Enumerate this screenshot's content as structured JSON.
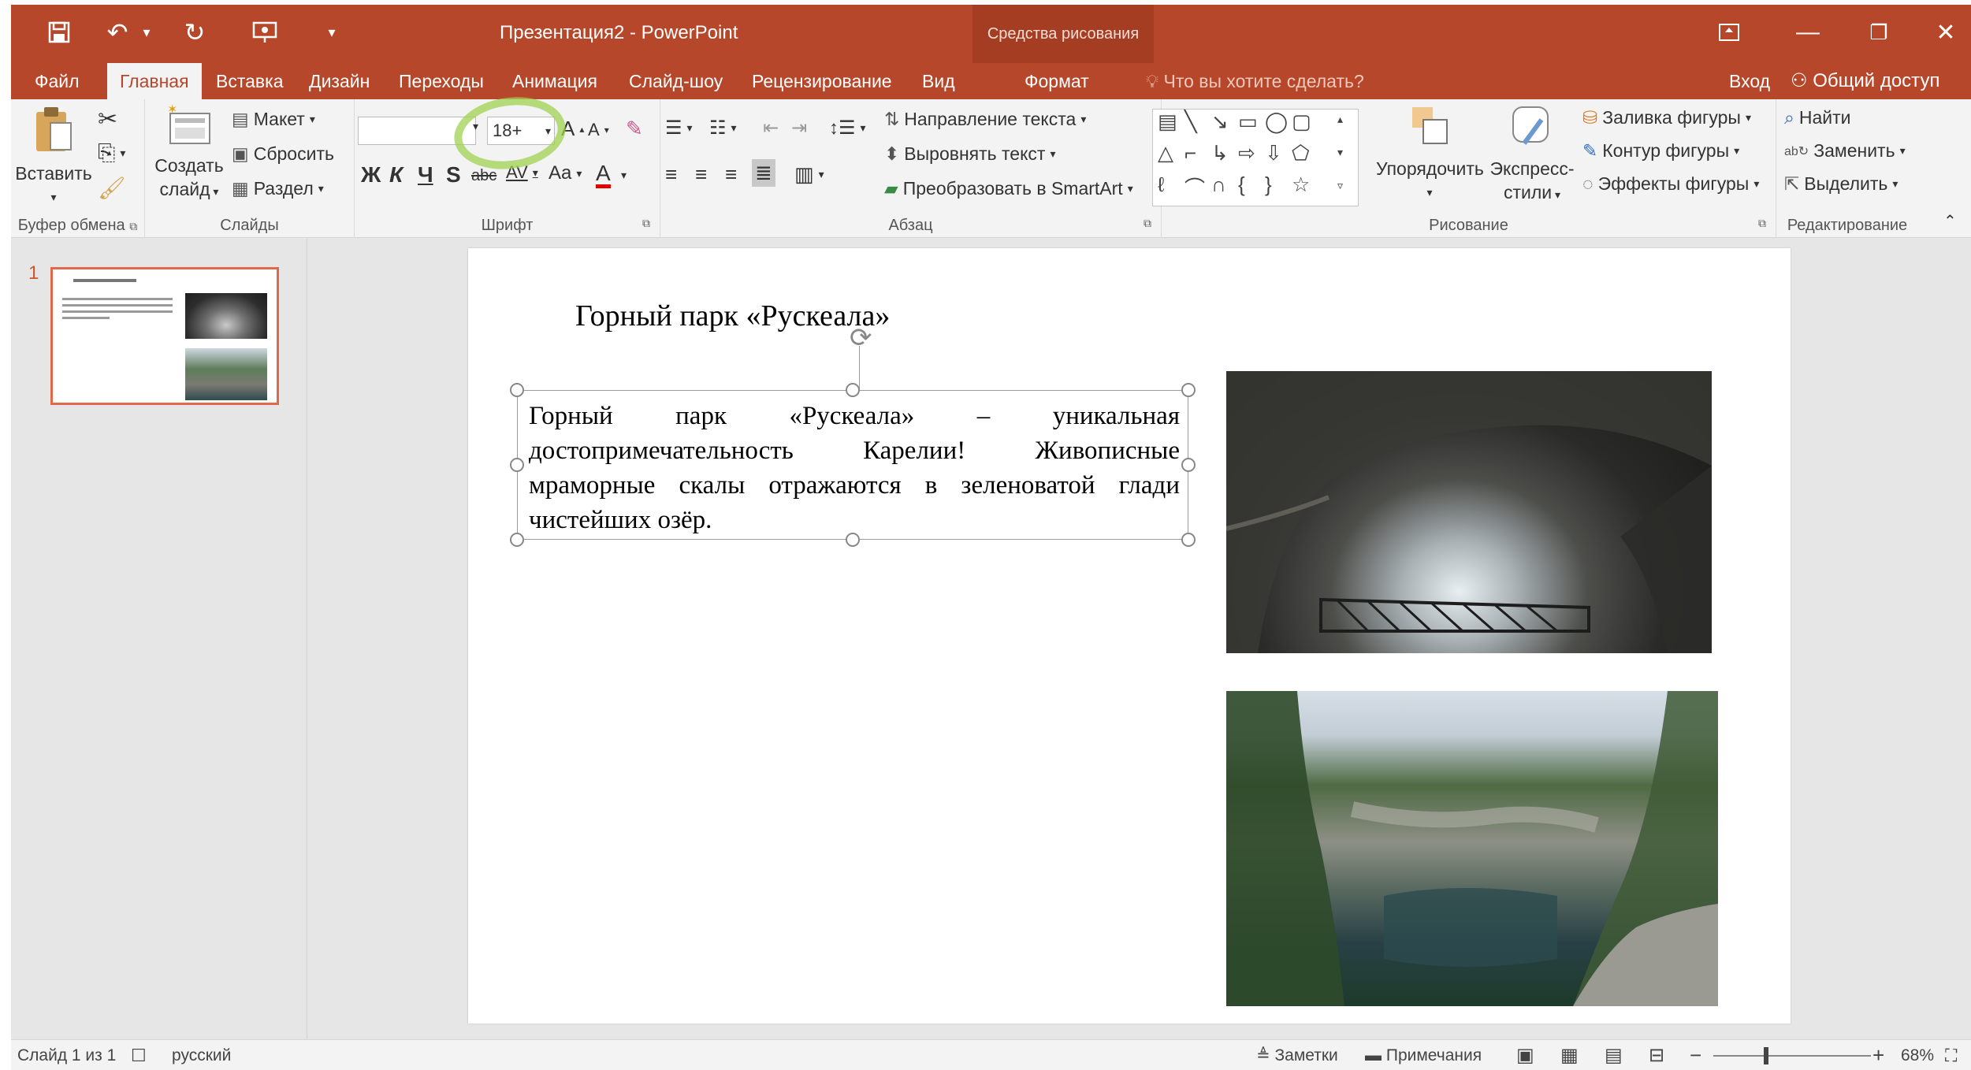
{
  "window": {
    "title": "Презентация2 - PowerPoint",
    "contextual_tab_group": "Средства рисования"
  },
  "tabs": [
    "Файл",
    "Главная",
    "Вставка",
    "Дизайн",
    "Переходы",
    "Анимация",
    "Слайд-шоу",
    "Рецензирование",
    "Вид",
    "Формат"
  ],
  "tell_me": "Что вы хотите сделать?",
  "sign_in": "Вход",
  "share": "Общий доступ",
  "ribbon": {
    "clipboard": {
      "paste": "Вставить",
      "label": "Буфер обмена"
    },
    "slides": {
      "new_slide_1": "Создать",
      "new_slide_2": "слайд",
      "layout": "Макет",
      "reset": "Сбросить",
      "section": "Раздел",
      "label": "Слайды"
    },
    "font": {
      "font_name": "",
      "font_size": "18+",
      "bold": "Ж",
      "italic": "К",
      "underline": "Ч",
      "shadow": "S",
      "strike": "abc",
      "spacing": "AV",
      "case": "Aa",
      "color": "A",
      "label": "Шрифт"
    },
    "paragraph": {
      "text_direction": "Направление текста",
      "align_text": "Выровнять текст",
      "smartart": "Преобразовать в SmartArt",
      "label": "Абзац"
    },
    "drawing": {
      "arrange": "Упорядочить",
      "quick_styles_1": "Экспресс-",
      "quick_styles_2": "стили",
      "fill": "Заливка фигуры",
      "outline": "Контур фигуры",
      "effects": "Эффекты фигуры",
      "label": "Рисование"
    },
    "editing": {
      "find": "Найти",
      "replace": "Заменить",
      "select": "Выделить",
      "label": "Редактирование"
    }
  },
  "thumbnails": [
    {
      "number": "1"
    }
  ],
  "slide": {
    "title": "Горный парк «Рускеала»",
    "body": "Горный парк «Рускеала» – уникальная достопримечательность Карелии! Живописные мраморные скалы отражаются в зеленоватой глади чистейших озёр."
  },
  "status": {
    "slide_info": "Слайд 1 из 1",
    "language": "русский",
    "notes": "Заметки",
    "comments": "Примечания",
    "zoom": "68%"
  },
  "colors": {
    "accent": "#b7472a",
    "highlight": "#a0d250"
  }
}
